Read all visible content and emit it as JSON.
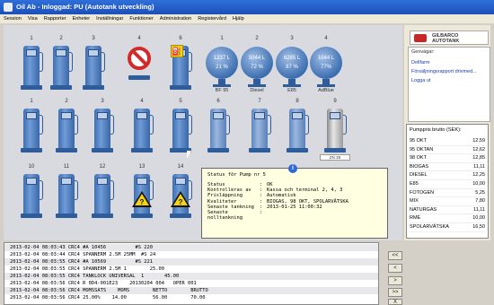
{
  "window": {
    "title": "Oil Ab - Inloggad: PU (Autotank utveckling)"
  },
  "menu": [
    "Session",
    "Visa",
    "Rapporter",
    "Enheter",
    "Inställningar",
    "Funktioner",
    "Administration",
    "Registervård",
    "Hjälp"
  ],
  "pumps_row1": [
    {
      "num": "1"
    },
    {
      "num": "2"
    },
    {
      "num": "3"
    },
    {
      "num": "4",
      "status": "blocked"
    },
    {
      "num": "6",
      "status": "fuel-warning"
    }
  ],
  "tanks": [
    {
      "num": "1",
      "value": "1237 L",
      "percent": "21 %",
      "name": "BF 95"
    },
    {
      "num": "2",
      "value": "5044 L",
      "percent": "72 %",
      "name": "Diesel"
    },
    {
      "num": "3",
      "value": "6285 L",
      "percent": "87 %",
      "name": "E85"
    },
    {
      "num": "4",
      "value": "1044 L",
      "percent": "77%",
      "name": "AdBlue"
    }
  ],
  "pumps_row2": [
    {
      "num": "1"
    },
    {
      "num": "2"
    },
    {
      "num": "3"
    },
    {
      "num": "4"
    },
    {
      "num": "5"
    },
    {
      "num": "6"
    },
    {
      "num": "7"
    },
    {
      "num": "8"
    },
    {
      "num": "9",
      "caption": "ZN 28"
    }
  ],
  "pumps_row3": [
    {
      "num": "10"
    },
    {
      "num": "11"
    },
    {
      "num": "12"
    },
    {
      "num": "13",
      "status": "warning"
    },
    {
      "num": "14",
      "status": "warning"
    }
  ],
  "status_popup": {
    "title": "Status för Pump nr 5",
    "rows": [
      {
        "k": "Status",
        "v": "OK"
      },
      {
        "k": "Kontrolleras av",
        "v": "Kassa och terminal 2, 4, 3"
      },
      {
        "k": "Frisläppning",
        "v": "Automatisk"
      },
      {
        "k": "Kvaliteter",
        "v": "BIOGAS, 98 OKT, SPOLARVÄTSKA"
      },
      {
        "k": "Senaste tankning",
        "v": "2013-01-25 11:00:32"
      },
      {
        "k": "Senaste nolltankning",
        "v": ""
      }
    ]
  },
  "brand": {
    "line1": "GILBARCO",
    "line2": "AUTOTANK"
  },
  "links": {
    "header": "Genvägar:",
    "items": [
      "Dellfarm",
      "Försäljningsrapport drivmed...",
      "Logga ut"
    ]
  },
  "prices": {
    "header": "Pumppris brutto (SEK):",
    "items": [
      {
        "name": "95 OKT",
        "price": "12,59"
      },
      {
        "name": "95 OKTAN",
        "price": "12,62"
      },
      {
        "name": "98 OKT",
        "price": "12,85"
      },
      {
        "name": "BIOGAS",
        "price": "11,11"
      },
      {
        "name": "DIESEL",
        "price": "12,25"
      },
      {
        "name": "E85",
        "price": "10,00"
      },
      {
        "name": "FOTOGEN",
        "price": "5,25"
      },
      {
        "name": "MIX",
        "price": "7,80"
      },
      {
        "name": "NATURGAS",
        "price": "11,11"
      },
      {
        "name": "RME",
        "price": "10,00"
      },
      {
        "name": "SPOLARVÄTSKA",
        "price": "16,50"
      }
    ]
  },
  "log": [
    "2013-02-04 08:03:43 CRC4 #A 10456          #S 220",
    "2013-02-04 08:03:44 CRC4 SPANNERM 2.5M 25MM  #S 24",
    "2013-02-04 08:03:55 CRC4 #A 10569          #S 221",
    "2013-02-04 08:03:55 CRC4 SPANNERM 2.5M 1        25.00",
    "2013-02-04 08:03:55 CRC4 TANKLOCK UNIVERSAL  1       45.00",
    "2013-02-04 08:03:56 CRC4 R 0D4-001E23    20130204 004   OPER 001",
    "2013-02-04 08:03:56 CRC4 MOMSSATS    MOMS        NETTO        BRUTTO",
    "2013-02-04 08:03:56 CRC4 25.00%    14.00         56.00        70.00"
  ],
  "nav_buttons": [
    "<<",
    "<",
    ">",
    ">>",
    "X"
  ]
}
